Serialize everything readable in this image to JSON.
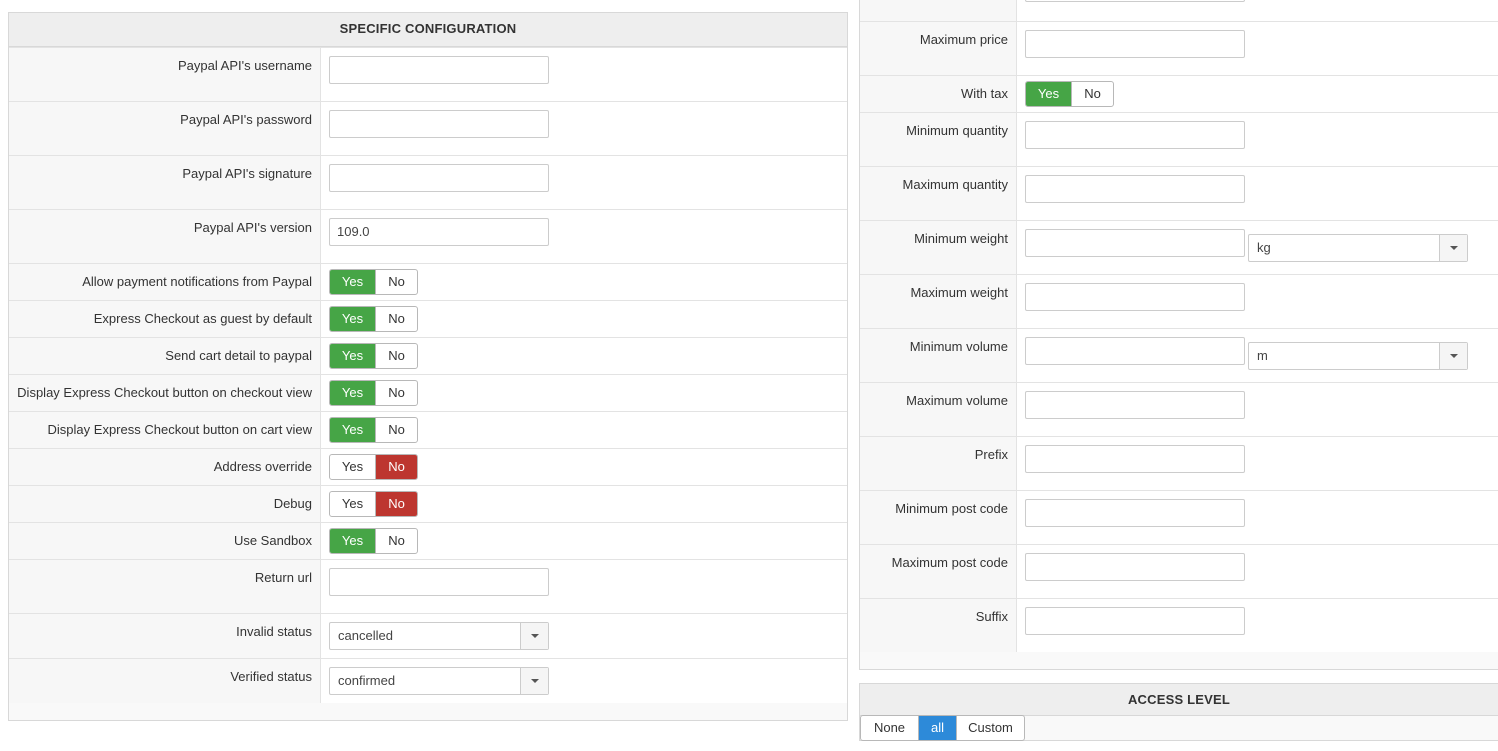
{
  "left": {
    "title": "SPECIFIC CONFIGURATION",
    "username_label": "Paypal API's username",
    "username_value": "",
    "password_label": "Paypal API's password",
    "password_value": "",
    "signature_label": "Paypal API's signature",
    "signature_value": "",
    "version_label": "Paypal API's version",
    "version_value": "109.0",
    "toggles": [
      {
        "label": "Allow payment notifications from Paypal",
        "yes": "Yes",
        "no": "No",
        "value": "yes"
      },
      {
        "label": "Express Checkout as guest by default",
        "yes": "Yes",
        "no": "No",
        "value": "yes"
      },
      {
        "label": "Send cart detail to paypal",
        "yes": "Yes",
        "no": "No",
        "value": "yes"
      },
      {
        "label": "Display Express Checkout button on checkout view",
        "yes": "Yes",
        "no": "No",
        "value": "yes"
      },
      {
        "label": "Display Express Checkout button on cart view",
        "yes": "Yes",
        "no": "No",
        "value": "yes"
      },
      {
        "label": "Address override",
        "yes": "Yes",
        "no": "No",
        "value": "no"
      },
      {
        "label": "Debug",
        "yes": "Yes",
        "no": "No",
        "value": "no"
      },
      {
        "label": "Use Sandbox",
        "yes": "Yes",
        "no": "No",
        "value": "yes"
      }
    ],
    "return_url_label": "Return url",
    "return_url_value": "",
    "invalid_status_label": "Invalid status",
    "invalid_status_value": "cancelled",
    "verified_status_label": "Verified status",
    "verified_status_value": "confirmed"
  },
  "right": {
    "max_price_label": "Maximum price",
    "with_tax_label": "With tax",
    "with_tax_yes": "Yes",
    "with_tax_no": "No",
    "with_tax_value": "yes",
    "min_qty_label": "Minimum quantity",
    "max_qty_label": "Maximum quantity",
    "min_weight_label": "Minimum weight",
    "weight_unit": "kg",
    "max_weight_label": "Maximum weight",
    "min_volume_label": "Minimum volume",
    "volume_unit": "m",
    "max_volume_label": "Maximum volume",
    "prefix_label": "Prefix",
    "min_postcode_label": "Minimum post code",
    "max_postcode_label": "Maximum post code",
    "suffix_label": "Suffix"
  },
  "access": {
    "title": "ACCESS LEVEL",
    "none": "None",
    "all": "all",
    "custom": "Custom",
    "selected": "all"
  },
  "colors": {
    "yes_active": "#46a546",
    "no_active": "#bd362f",
    "segment_active": "#2d8ad9"
  }
}
